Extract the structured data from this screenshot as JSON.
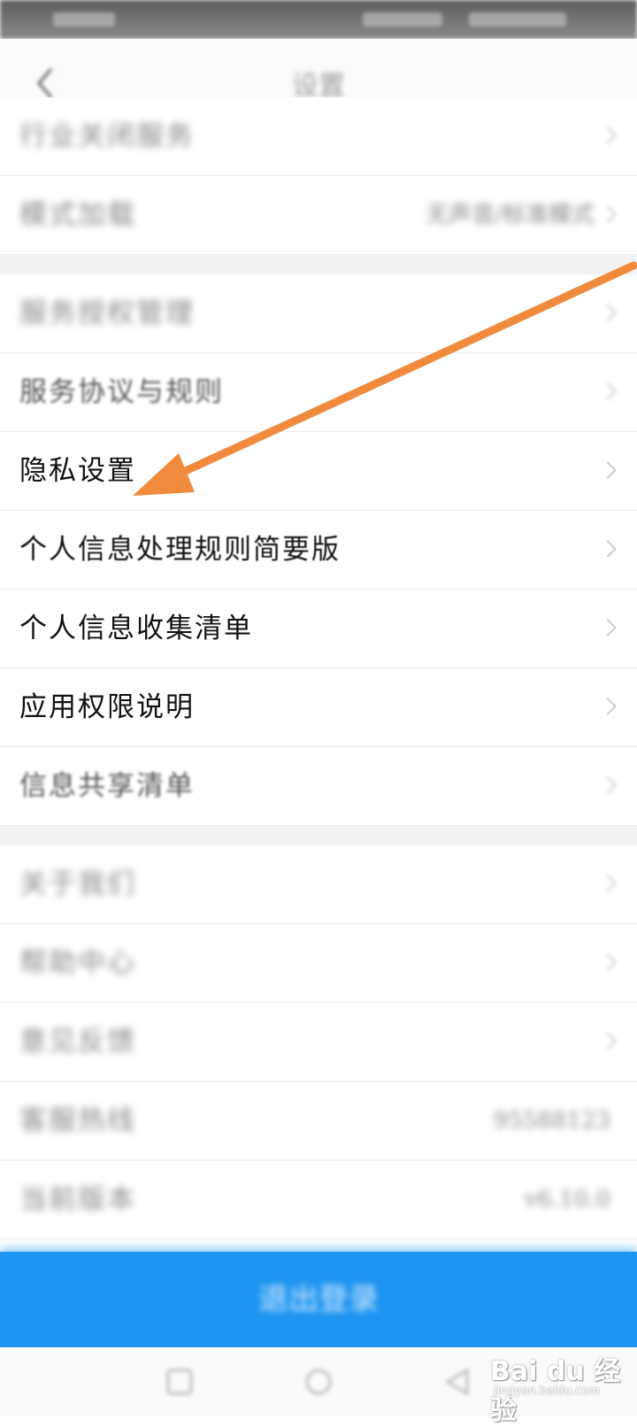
{
  "header": {
    "title": "设置"
  },
  "groups": [
    {
      "items": [
        {
          "label": "行业关闭服务",
          "value": ""
        },
        {
          "label": "模式加载",
          "value": "无声音/标准模式"
        }
      ]
    },
    {
      "items": [
        {
          "label": "服务授权管理",
          "value": ""
        },
        {
          "label": "服务协议与规则",
          "value": ""
        },
        {
          "label": "隐私设置",
          "value": ""
        },
        {
          "label": "个人信息处理规则简要版",
          "value": ""
        },
        {
          "label": "个人信息收集清单",
          "value": ""
        },
        {
          "label": "应用权限说明",
          "value": ""
        },
        {
          "label": "信息共享清单",
          "value": ""
        }
      ]
    },
    {
      "items": [
        {
          "label": "关于我们",
          "value": ""
        },
        {
          "label": "帮助中心",
          "value": ""
        },
        {
          "label": "意见反馈",
          "value": ""
        },
        {
          "label": "客服热线",
          "value": "95588123"
        },
        {
          "label": "当前版本",
          "value": "v6.10.0"
        }
      ]
    }
  ],
  "logout_button": {
    "label": "退出登录"
  },
  "watermark": {
    "brand": "Bai du 经验",
    "url": "jingyan.baidu.com"
  },
  "colors": {
    "accent": "#1e95f0",
    "arrow": "#f08a3c"
  },
  "icons": [
    "back-icon",
    "chevron-right-icon",
    "home-nav-icon",
    "circle-nav-icon",
    "back-nav-icon"
  ]
}
